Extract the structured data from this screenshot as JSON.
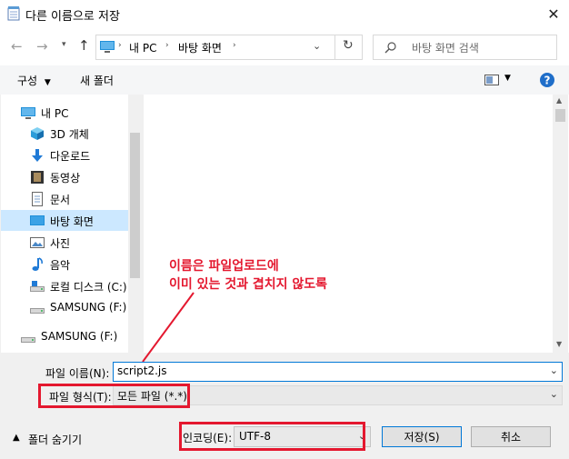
{
  "window": {
    "title": "다른 이름으로 저장"
  },
  "nav": {
    "path": [
      "내 PC",
      "바탕 화면"
    ],
    "search_placeholder": "바탕 화면 검색"
  },
  "toolbar": {
    "organize_label": "구성",
    "new_folder_label": "새 폴더"
  },
  "tree": [
    {
      "label": "내 PC",
      "icon": "pc-icon"
    },
    {
      "label": "3D 개체",
      "icon": "cube-icon"
    },
    {
      "label": "다운로드",
      "icon": "download-icon"
    },
    {
      "label": "동영상",
      "icon": "video-icon"
    },
    {
      "label": "문서",
      "icon": "document-icon"
    },
    {
      "label": "바탕 화면",
      "icon": "desktop-icon",
      "selected": true
    },
    {
      "label": "사진",
      "icon": "picture-icon"
    },
    {
      "label": "음악",
      "icon": "music-icon"
    },
    {
      "label": "로컬 디스크 (C:)",
      "icon": "drive-icon"
    },
    {
      "label": "SAMSUNG (F:)",
      "icon": "drive-icon"
    },
    {
      "label": "SAMSUNG (F:)",
      "icon": "drive-icon"
    }
  ],
  "annotation": {
    "line1": "이름은 파일업로드에",
    "line2": "이미 있는 것과 겹치지 않도록",
    "color": "#e4182f"
  },
  "form": {
    "filename_label": "파일 이름(N):",
    "filename_value": "script2.js",
    "filetype_label": "파일 형식(T):",
    "filetype_value": "모든 파일 (*.*)"
  },
  "footer": {
    "hide_folders_label": "폴더 숨기기",
    "encoding_label": "인코딩(E):",
    "encoding_value": "UTF-8",
    "save_label": "저장(S)",
    "cancel_label": "취소"
  }
}
